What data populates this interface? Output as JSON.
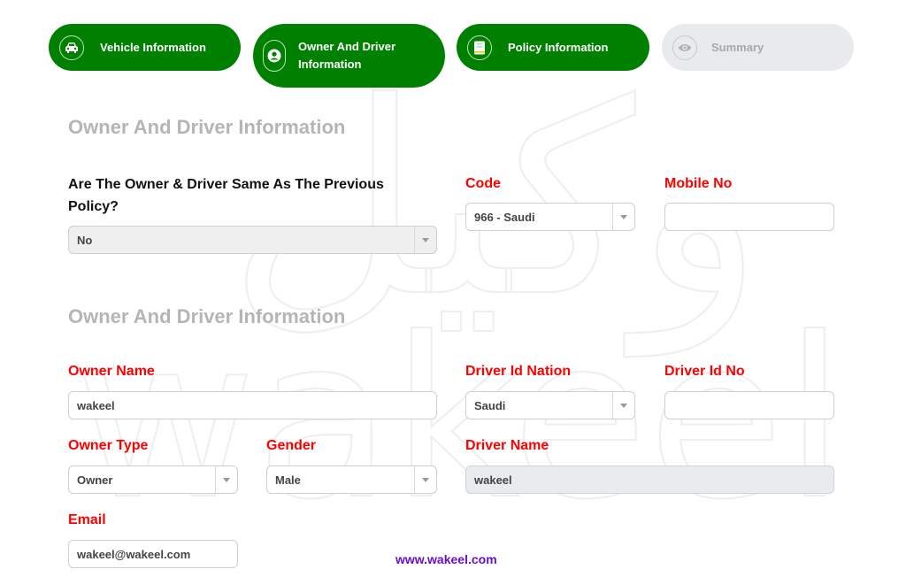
{
  "stepper": {
    "steps": [
      {
        "label": "Vehicle Information",
        "icon": "car-icon",
        "state": "completed"
      },
      {
        "label": "Owner And Driver Information",
        "label_line1": "Owner And Driver",
        "label_line2": "Information",
        "icon": "user-icon",
        "state": "active"
      },
      {
        "label": "Policy Information",
        "icon": "book-icon",
        "state": "completed"
      },
      {
        "label": "Summary",
        "icon": "eye-icon",
        "state": "inactive"
      }
    ],
    "active_color": "#008000",
    "inactive_color": "#e8eaed"
  },
  "section1": {
    "title": "Owner And Driver Information",
    "same_owner_question": "Are The Owner & Driver Same As The Previous Policy?",
    "same_owner_value": "No",
    "code_label": "Code",
    "code_value": "966 - Saudi",
    "mobile_label": "Mobile No",
    "mobile_value": ""
  },
  "section2": {
    "title": "Owner And Driver Information",
    "owner_name_label": "Owner Name",
    "owner_name_value": "wakeel",
    "driver_id_nation_label": "Driver Id Nation",
    "driver_id_nation_value": "Saudi",
    "driver_id_no_label": "Driver Id No",
    "driver_id_no_value": "",
    "owner_type_label": "Owner Type",
    "owner_type_value": "Owner",
    "gender_label": "Gender",
    "gender_value": "Male",
    "driver_name_label": "Driver Name",
    "driver_name_value": "wakeel",
    "email_label": "Email",
    "email_value": "wakeel@wakeel.com"
  },
  "footer": {
    "website": "www.wakeel.com"
  },
  "watermark": {
    "latin": "wakeel",
    "arabic": "وكيل"
  },
  "colors": {
    "required_label": "#ff0000",
    "section_title": "#b5b5b5",
    "footer_link": "#6a0dcc"
  }
}
